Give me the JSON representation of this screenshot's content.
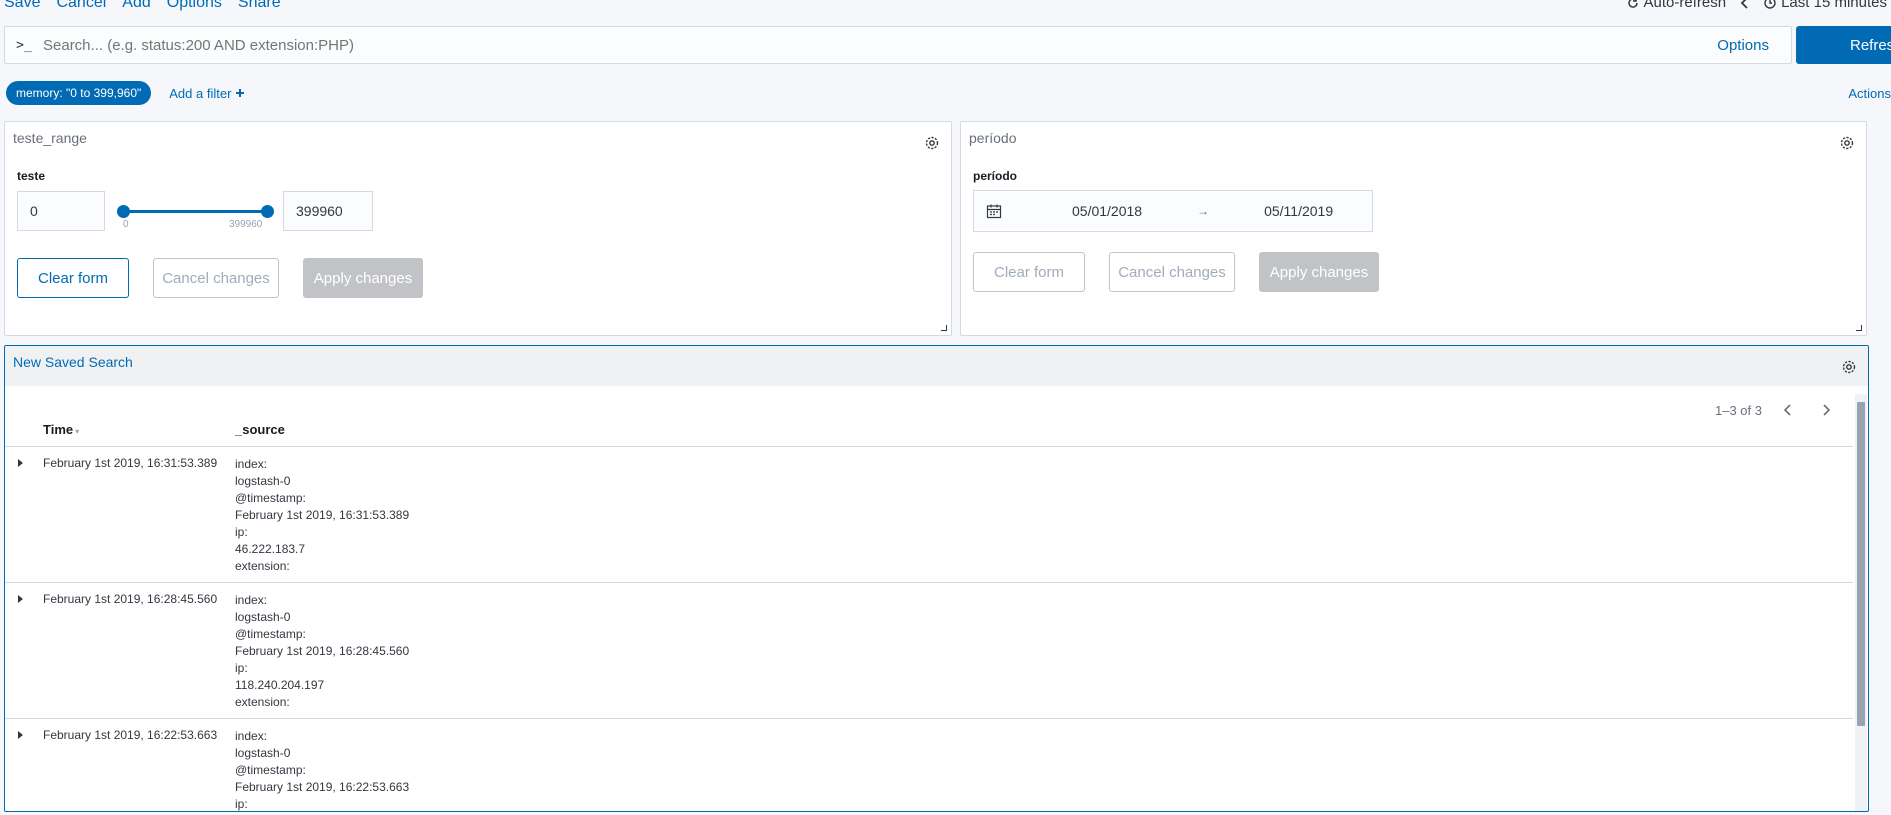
{
  "top_menu": [
    "Save",
    "Cancel",
    "Add",
    "Options",
    "Share"
  ],
  "time_controls": {
    "auto_refresh": "Auto-refresh",
    "time_range": "Last 15 minutes"
  },
  "query": {
    "prompt": ">_",
    "placeholder": "Search... (e.g. status:200 AND extension:PHP)",
    "options_label": "Options",
    "refresh_label": "Refresh"
  },
  "filters": {
    "pill": "memory: \"0 to 399,960\"",
    "add_filter": "Add a filter",
    "actions": "Actions"
  },
  "panel_range": {
    "title": "teste_range",
    "label": "teste",
    "min_value": "0",
    "max_value": "399960",
    "tick_min": "0",
    "tick_max": "399960",
    "clear": "Clear form",
    "cancel": "Cancel changes",
    "apply": "Apply changes"
  },
  "panel_period": {
    "title": "período",
    "label": "período",
    "start": "05/01/2018",
    "arrow": "→",
    "end": "05/11/2019",
    "clear": "Clear form",
    "cancel": "Cancel changes",
    "apply": "Apply changes"
  },
  "saved_search": {
    "title": "New Saved Search",
    "pager": "1–3 of 3",
    "columns": {
      "time": "Time",
      "source": "_source"
    },
    "rows": [
      {
        "time": "February 1st 2019, 16:31:53.389",
        "lines": [
          "index:",
          "logstash-0",
          "@timestamp:",
          "February 1st 2019, 16:31:53.389",
          "ip:",
          "46.222.183.7",
          "extension:"
        ]
      },
      {
        "time": "February 1st 2019, 16:28:45.560",
        "lines": [
          "index:",
          "logstash-0",
          "@timestamp:",
          "February 1st 2019, 16:28:45.560",
          "ip:",
          "118.240.204.197",
          "extension:"
        ]
      },
      {
        "time": "February 1st 2019, 16:22:53.663",
        "lines": [
          "index:",
          "logstash-0",
          "@timestamp:",
          "February 1st 2019, 16:22:53.663",
          "ip:"
        ]
      }
    ]
  }
}
